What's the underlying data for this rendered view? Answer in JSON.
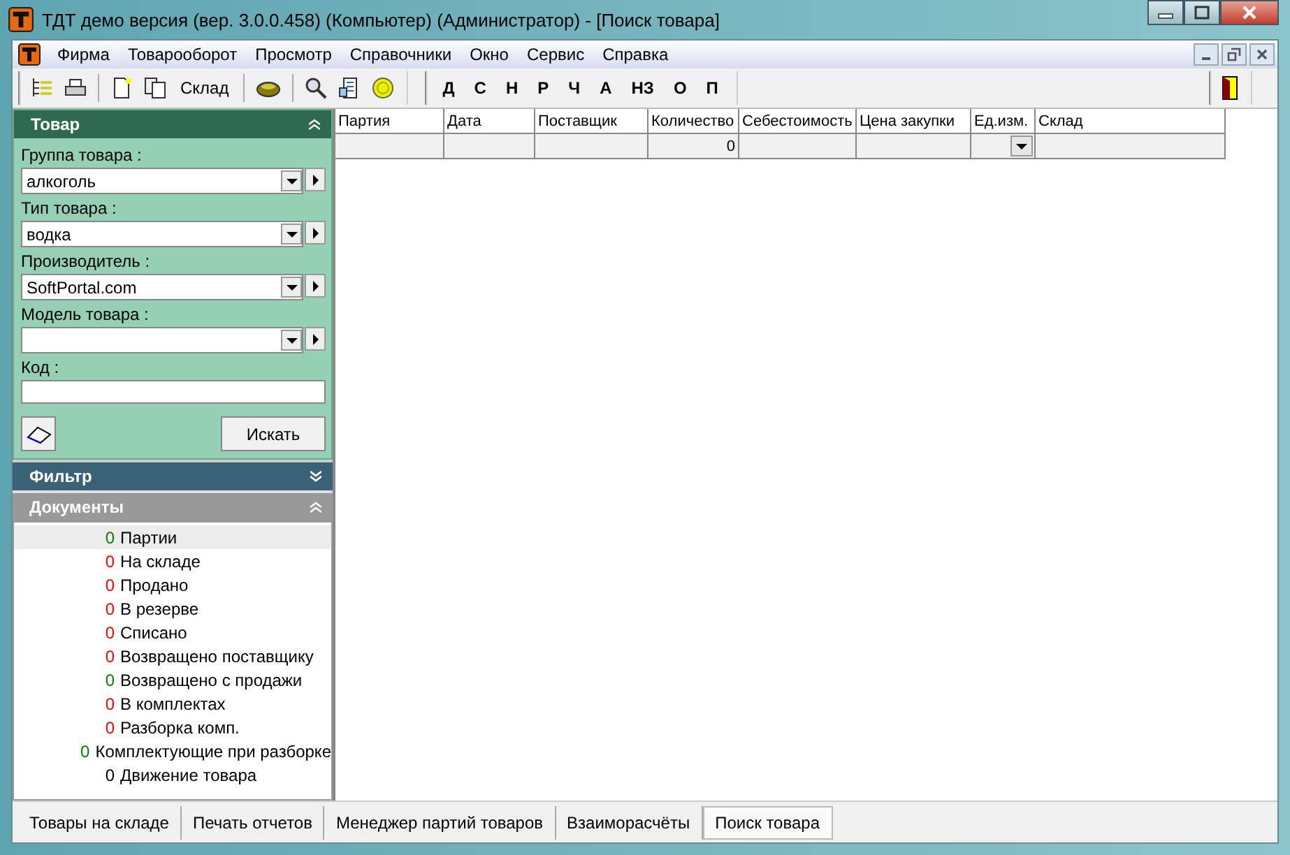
{
  "window": {
    "title": "ТДТ демо версия (вер. 3.0.0.458) (Компьютер) (Администратор) - [Поиск товара]"
  },
  "menu": [
    "Фирма",
    "Товарооборот",
    "Просмотр",
    "Справочники",
    "Окно",
    "Сервис",
    "Справка"
  ],
  "toolbar": {
    "sklad_label": "Склад",
    "letters": [
      "Д",
      "С",
      "Н",
      "Р",
      "Ч",
      "А",
      "НЗ",
      "О",
      "П"
    ]
  },
  "goods_panel": {
    "title": "Товар",
    "fields": [
      {
        "label": "Группа товара :",
        "value": "алкоголь"
      },
      {
        "label": "Тип товара :",
        "value": "водка"
      },
      {
        "label": "Производитель :",
        "value": "SoftPortal.com"
      },
      {
        "label": "Модель товара :"
      }
    ],
    "code_label": "Код :",
    "search_button": "Искать"
  },
  "filter_panel": {
    "title": "Фильтр"
  },
  "documents_panel": {
    "title": "Документы",
    "items": [
      {
        "count": "0",
        "color": "#008000",
        "label": "Партии",
        "selected": true
      },
      {
        "count": "0",
        "color": "#ff0000",
        "label": "На складе",
        "selected": false
      },
      {
        "count": "0",
        "color": "#ff0000",
        "label": "Продано",
        "selected": false
      },
      {
        "count": "0",
        "color": "#ff0000",
        "label": "В резерве",
        "selected": false
      },
      {
        "count": "0",
        "color": "#ff0000",
        "label": "Списано",
        "selected": false
      },
      {
        "count": "0",
        "color": "#ff0000",
        "label": "Возвращено поставщику",
        "selected": false
      },
      {
        "count": "0",
        "color": "#008000",
        "label": "Возвращено с продажи",
        "selected": false
      },
      {
        "count": "0",
        "color": "#ff0000",
        "label": "В комплектах",
        "selected": false
      },
      {
        "count": "0",
        "color": "#ff0000",
        "label": "Разборка комп.",
        "selected": false
      },
      {
        "count": "0",
        "color": "#008000",
        "label": "Комплектующие при разборке",
        "selected": false
      },
      {
        "count": "0",
        "color": "#000000",
        "label": "Движение товара",
        "selected": false
      }
    ]
  },
  "table": {
    "columns": [
      "Партия",
      "Дата",
      "Поставщик",
      "Количество",
      "Себестоимость",
      "Цена закупки",
      "Ед.изм.",
      "Склад"
    ],
    "rows": [
      [
        "",
        "",
        "",
        "0",
        "",
        "",
        "",
        ""
      ]
    ]
  },
  "tabs": [
    {
      "label": "Товары на складе",
      "selected": false
    },
    {
      "label": "Печать отчетов",
      "selected": false
    },
    {
      "label": "Менеджер партий товаров",
      "selected": false
    },
    {
      "label": "Взаиморасчёты",
      "selected": false
    },
    {
      "label": "Поиск товара",
      "selected": true
    }
  ]
}
